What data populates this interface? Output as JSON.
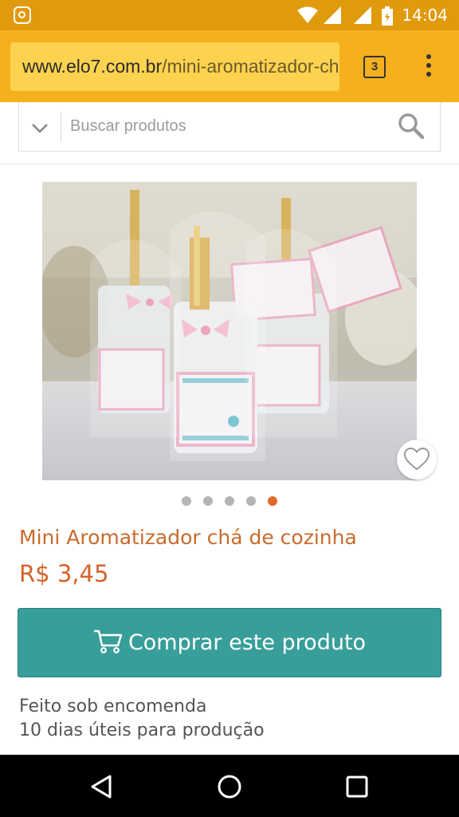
{
  "status_bar": {
    "time": "14:04",
    "icons": [
      "instagram-icon",
      "wifi-icon",
      "signal-icon",
      "signal-icon",
      "battery-icon"
    ]
  },
  "browser": {
    "url_domain": "www.elo7.com.br",
    "url_path": "/mini-aromatizador-cha-de-cozinha",
    "tab_count": "3",
    "menu_icon": "more-vert-icon"
  },
  "search": {
    "placeholder": "Buscar produtos",
    "value": "",
    "icons": [
      "chevron-down-icon",
      "search-icon"
    ]
  },
  "product": {
    "image_description": "mini aromatizador bottles wrapped in cellophane with pink ribbons and teapot labels",
    "carousel_total": 5,
    "carousel_active_index": 4,
    "title": "Mini Aromatizador chá de cozinha",
    "price": "R$ 3,45",
    "buy_label": "Comprar este produto",
    "info_line1": "Feito sob encomenda",
    "info_line2": "10 dias úteis para produção"
  },
  "colors": {
    "accent": "#f5b01d",
    "price": "#d4622a",
    "buy_button": "#389e99",
    "active_dot": "#e06a2a"
  },
  "nav": [
    "back-icon",
    "home-icon",
    "recents-icon"
  ]
}
